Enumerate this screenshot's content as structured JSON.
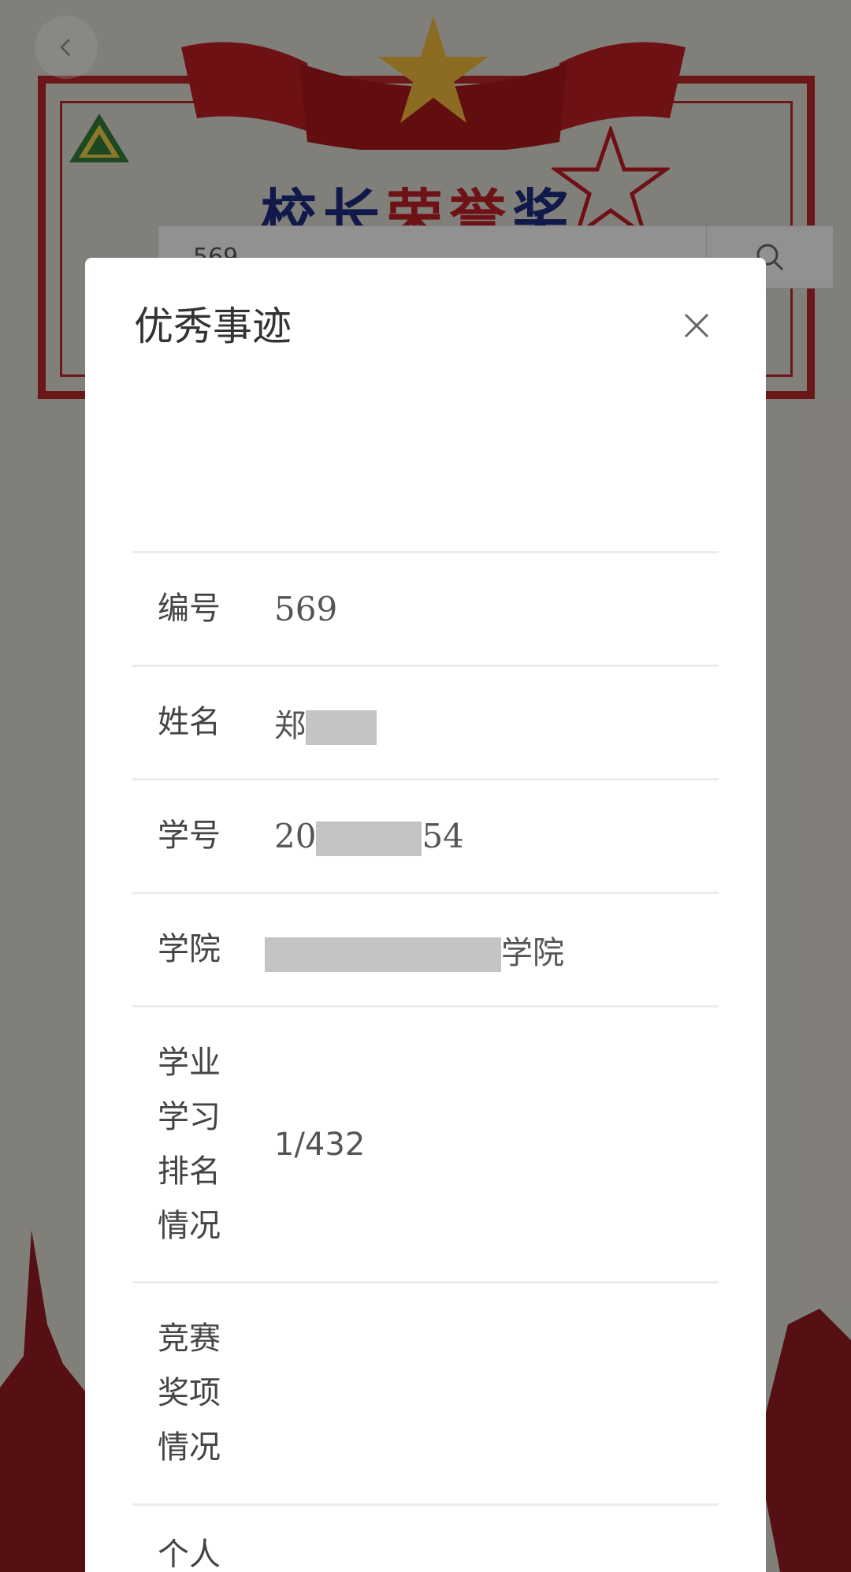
{
  "background": {
    "banner_title": {
      "part1": "校长",
      "part2": "荣誉",
      "part3": "奖"
    }
  },
  "search": {
    "value": "569"
  },
  "modal": {
    "title": "优秀事迹",
    "rows": [
      {
        "label": "编号",
        "value": "569"
      },
      {
        "label": "姓名",
        "value_prefix": "郑"
      },
      {
        "label": "学号",
        "value_prefix": "20",
        "value_suffix": "54"
      },
      {
        "label": "学院",
        "value_suffix": "学院"
      },
      {
        "label": "学业\n学习\n排名\n情况",
        "value": "1/432"
      },
      {
        "label": "竞赛\n奖项\n情况",
        "value": ""
      },
      {
        "label": "个人",
        "value": ""
      }
    ]
  },
  "colors": {
    "frame_red": "#b3262b",
    "title_blue": "#1b2a7a"
  },
  "icons": [
    "back-chevron-icon",
    "search-icon",
    "close-icon",
    "school-logo-icon",
    "star-icon"
  ]
}
